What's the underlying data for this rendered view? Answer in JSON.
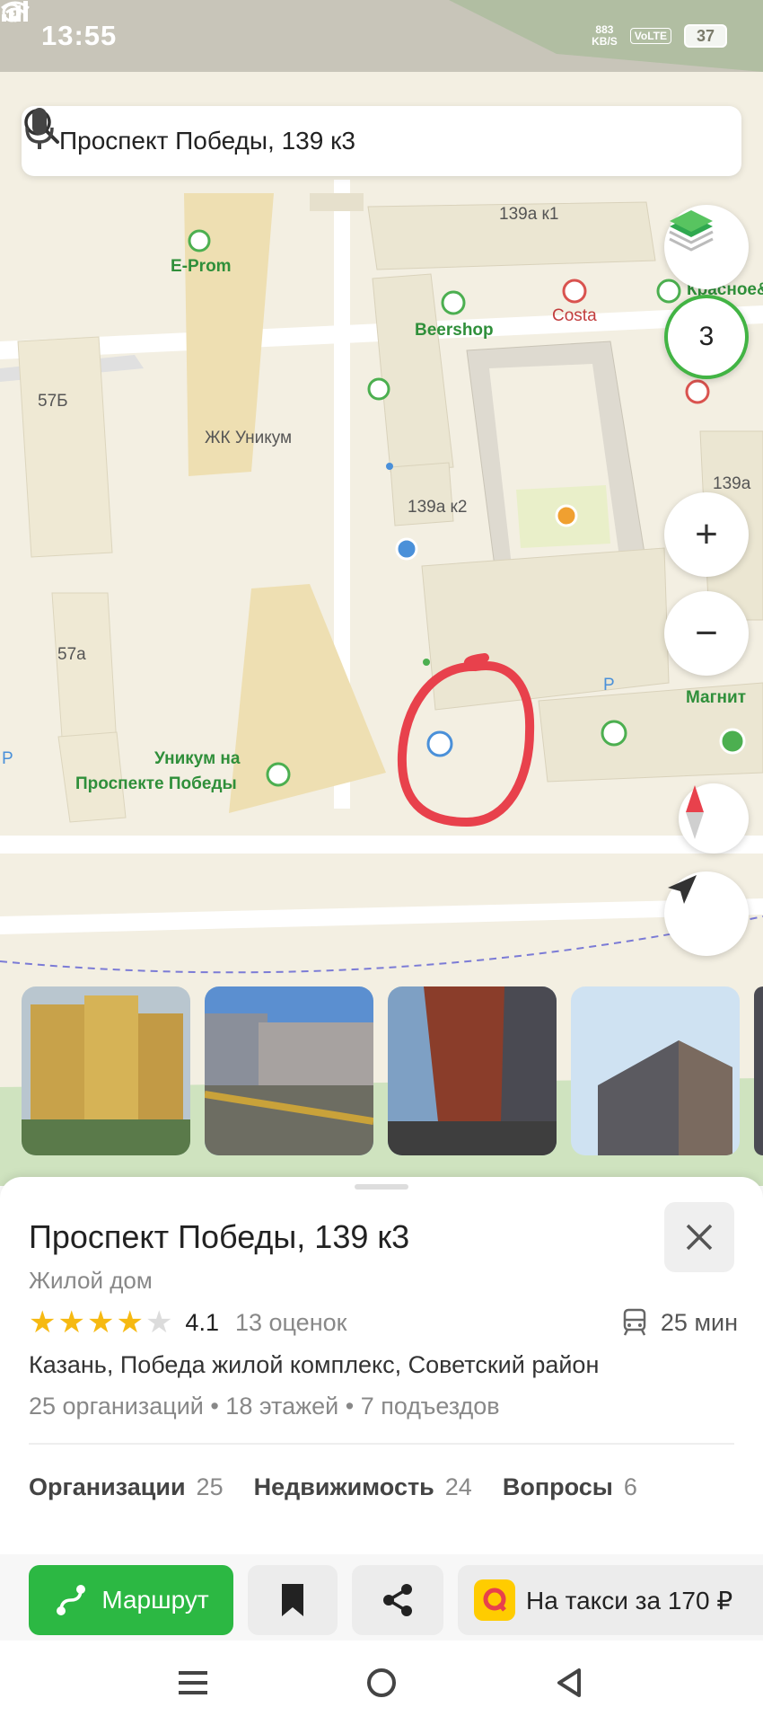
{
  "status_bar": {
    "time": "13:55",
    "net_speed_value": "883",
    "net_speed_unit": "KB/S",
    "volte": "VoLTE",
    "battery": "37"
  },
  "search": {
    "value": "Проспект Победы, 139 к3"
  },
  "map": {
    "labels": {
      "eprom": "E-Prom",
      "b57b": "57Б",
      "zhk": "ЖК Уникум",
      "beershop": "Beershop",
      "costa": "Costa",
      "krasnoe": "Красное&",
      "b139a_k1": "139а к1",
      "b139a_k2": "139а к2",
      "b139a": "139а",
      "b57a": "57а",
      "unikum_1": "Уникум на",
      "unikum_2": "Проспекте Победы",
      "magnit": "Магнит",
      "p_left": "P",
      "p_right": "P"
    },
    "traffic_level": "3",
    "highlight_color": "#e8414c"
  },
  "place": {
    "title": "Проспект Победы, 139 к3",
    "type": "Жилой дом",
    "rating_stars": 4,
    "rating_value": "4.1",
    "rating_count": "13 оценок",
    "travel_time": "25 мин",
    "address": "Казань, Победа жилой комплекс, Советский район",
    "facts": "25 организаций • 18 этажей • 7 подъездов"
  },
  "tabs": [
    {
      "label": "Организации",
      "count": "25"
    },
    {
      "label": "Недвижимость",
      "count": "24"
    },
    {
      "label": "Вопросы",
      "count": "6"
    }
  ],
  "actions": {
    "route": "Маршрут",
    "taxi": "На такси за 170 ₽"
  },
  "colors": {
    "accent_green": "#2cb843",
    "star_yellow": "#f6b912",
    "taxi_yellow": "#ffcc00"
  }
}
